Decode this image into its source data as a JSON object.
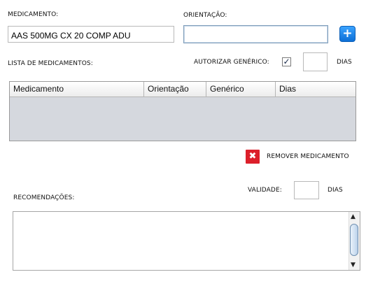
{
  "medicamento": {
    "label": "MEDICAMENTO:",
    "value": "AAS 500MG CX 20 COMP ADU"
  },
  "orientacao": {
    "label": "ORIENTAÇÃO:",
    "value": ""
  },
  "add_button": {
    "symbol": "+",
    "icon": "plus-icon"
  },
  "lista": {
    "label": "LISTA DE MEDICAMENTOS:"
  },
  "generico": {
    "label": "AUTORIZAR GENÉRICO:",
    "checked": true,
    "check_mark": "✓",
    "dias_value": "",
    "dias_label": "DIAS"
  },
  "table": {
    "columns": [
      "Medicamento",
      "Orientação",
      "Genérico",
      "Dias"
    ],
    "rows": []
  },
  "remove": {
    "label": "REMOVER MEDICAMENTO",
    "symbol": "✖",
    "icon": "remove-icon",
    "color": "#dc1f2a"
  },
  "recomendacoes": {
    "label": "RECOMENDAÇÕES:",
    "value": ""
  },
  "validade": {
    "label": "VALIDADE:",
    "value": "",
    "dias_label": "DIAS"
  },
  "scrollbar": {
    "up": "▲",
    "down": "▼"
  },
  "colors": {
    "accent": "#1a86f0",
    "table_bg": "#d5d8de"
  }
}
